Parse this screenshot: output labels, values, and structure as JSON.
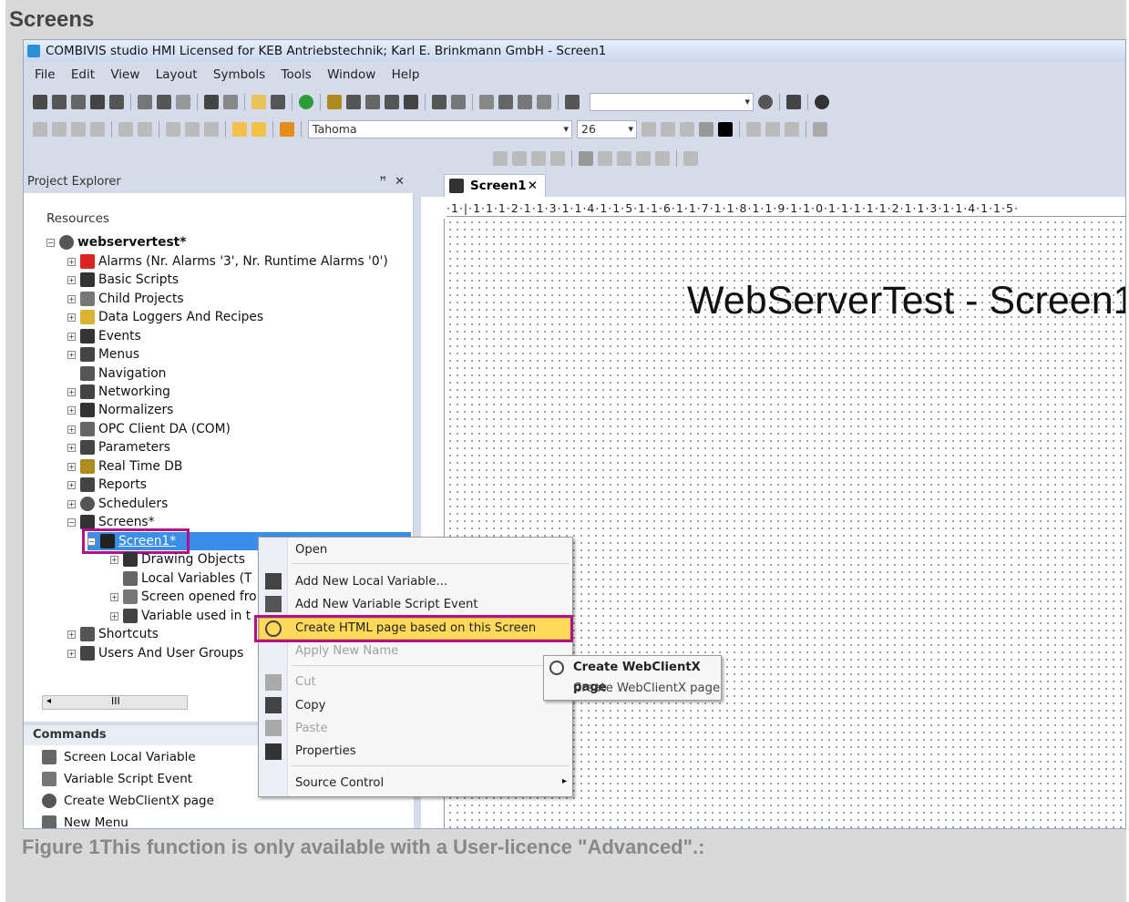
{
  "doc_title": "Screens",
  "caption": "Figure 1This function is only available with a User-licence \"Advanced\".:",
  "window": {
    "title": "COMBIVIS studio HMI Licensed for KEB Antriebstechnik; Karl E. Brinkmann GmbH - Screen1"
  },
  "menu": [
    "File",
    "Edit",
    "View",
    "Layout",
    "Symbols",
    "Tools",
    "Window",
    "Help"
  ],
  "toolbar": {
    "font_name": "Tahoma",
    "font_size": "26"
  },
  "project_explorer": {
    "title": "Project Explorer",
    "pin": "ꟸ",
    "close": "✕",
    "resources_label": "Resources",
    "root": "webservertest*",
    "items": [
      "Alarms (Nr. Alarms '3', Nr. Runtime Alarms '0')",
      "Basic Scripts",
      "Child Projects",
      "Data Loggers And Recipes",
      "Events",
      "Menus",
      "Navigation",
      "Networking",
      "Normalizers",
      "OPC Client DA (COM)",
      "Parameters",
      "Real Time DB",
      "Reports",
      "Schedulers",
      "Screens*"
    ],
    "screen1": "Screen1*",
    "screen1_children": [
      "Drawing Objects",
      "Local Variables (T",
      "Screen opened fro",
      "Variable used in t"
    ],
    "tail_items": [
      "Shortcuts",
      "Users And User Groups"
    ],
    "scroll_text": "III"
  },
  "commands": {
    "title": "Commands",
    "items": [
      "Screen Local Variable",
      "Variable Script Event",
      "Create WebClientX page",
      "New Menu"
    ]
  },
  "document": {
    "tab_label": "Screen1",
    "tab_close": "✕",
    "ruler_text": "·1·|·1·1·1·2·1·1·3·1·1·4·1·1·5·1·1·6·1·1·7·1·1·8·1·1·9·1·1·0·1·1·1·1·1·2·1·1·3·1·1·4·1·1·5·",
    "canvas_heading": "WebServerTest - Screen1"
  },
  "context_menu": {
    "open": "Open",
    "add_local_var": "Add New Local Variable...",
    "add_script_event": "Add New Variable Script Event",
    "create_html": "Create HTML page based on this Screen",
    "apply_name": "Apply New Name",
    "cut": "Cut",
    "copy": "Copy",
    "paste": "Paste",
    "properties": "Properties",
    "source_control": "Source Control"
  },
  "submenu": {
    "item1": "Create WebClientX page",
    "item2": "Create WebClientX page"
  },
  "colors": {
    "highlight_box": "#b0128a",
    "menu_highlight": "#ffd95a",
    "selection": "#3b8ee8"
  }
}
